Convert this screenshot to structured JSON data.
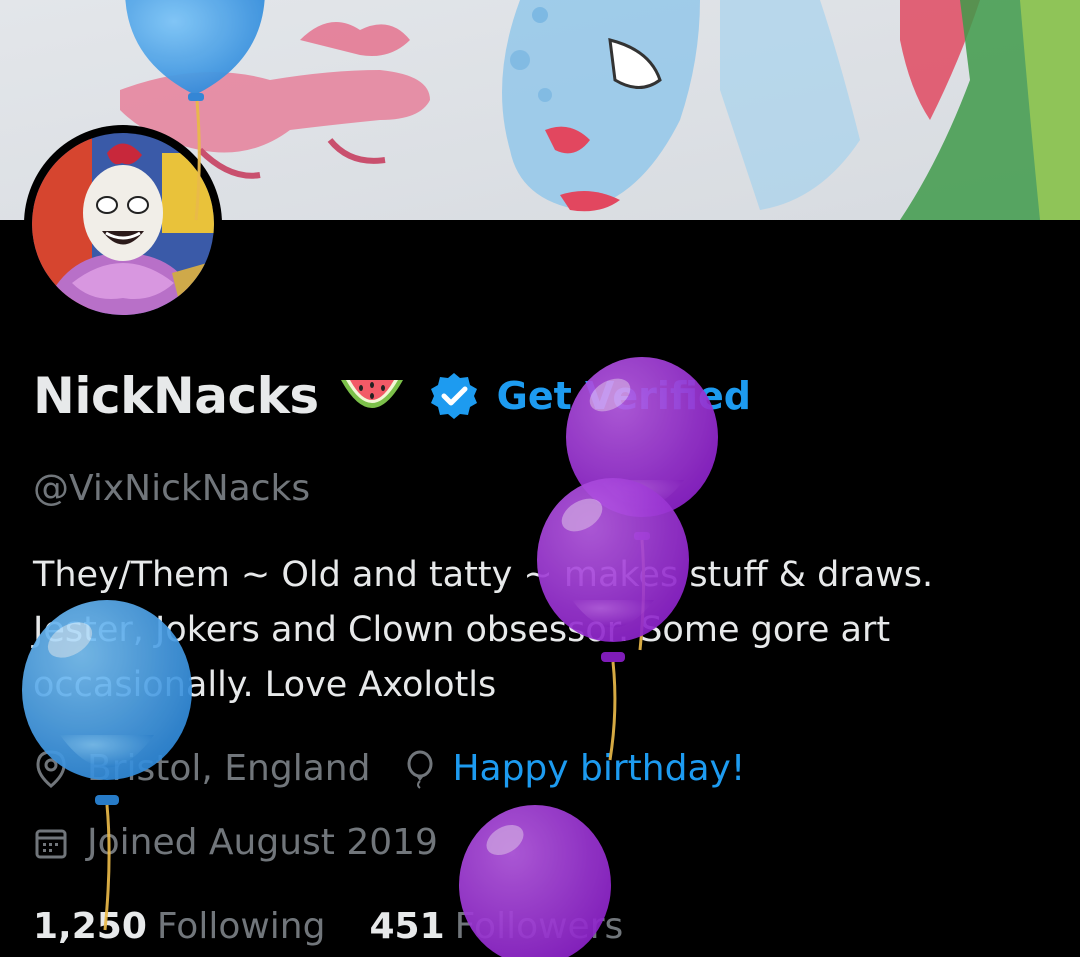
{
  "profile": {
    "display_name": "NickNacks",
    "name_emoji": "watermelon-icon",
    "verified_badge": "verified-check-icon",
    "get_verified_label": "Get Verified",
    "handle": "@VixNickNacks",
    "bio_lines": [
      "They/Them ~ Old and tatty ~ makes stuff & draws.",
      "Jester, Jokers and Clown obsessor. Some gore art",
      "occasionally. Love Axolotls"
    ],
    "location": "Bristol, England",
    "birthday_label": "Happy birthday!",
    "joined": "Joined August 2019",
    "following_count": "1,250",
    "following_label": "Following",
    "followers_count": "451",
    "followers_label": "Followers"
  },
  "colors": {
    "background": "#000000",
    "primary_text": "#e7e9ea",
    "secondary_text": "#71767b",
    "accent": "#1d9bf0",
    "balloon_blue": "#3aa0f0",
    "balloon_purple": "#9b2fd6"
  },
  "icons": {
    "location": "location-pin-icon",
    "birthday": "balloon-icon",
    "joined": "calendar-icon"
  }
}
